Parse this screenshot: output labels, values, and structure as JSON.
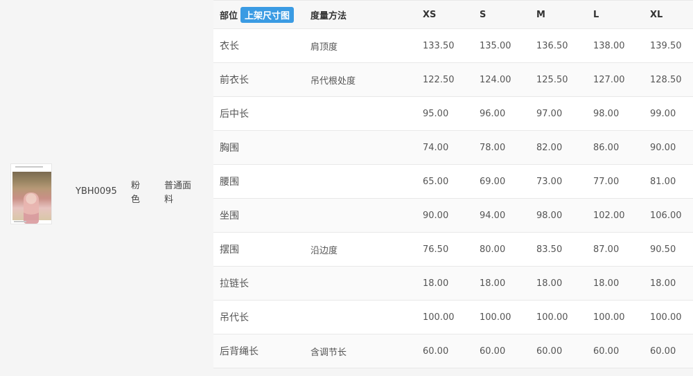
{
  "product": {
    "code": "YBH0095",
    "color": "粉色",
    "fabric": "普通面料"
  },
  "table": {
    "headers": {
      "part": "部位",
      "badge": "上架尺寸图",
      "method": "度量方法",
      "xs": "XS",
      "s": "S",
      "m": "M",
      "l": "L",
      "xl": "XL"
    },
    "rows": [
      {
        "part": "衣长",
        "method": "肩顶度",
        "xs": "133.50",
        "s": "135.00",
        "m": "136.50",
        "l": "138.00",
        "xl": "139.50"
      },
      {
        "part": "前衣长",
        "method": "吊代根处度",
        "xs": "122.50",
        "s": "124.00",
        "m": "125.50",
        "l": "127.00",
        "xl": "128.50"
      },
      {
        "part": "后中长",
        "method": "",
        "xs": "95.00",
        "s": "96.00",
        "m": "97.00",
        "l": "98.00",
        "xl": "99.00"
      },
      {
        "part": "胸围",
        "method": "",
        "xs": "74.00",
        "s": "78.00",
        "m": "82.00",
        "l": "86.00",
        "xl": "90.00"
      },
      {
        "part": "腰围",
        "method": "",
        "xs": "65.00",
        "s": "69.00",
        "m": "73.00",
        "l": "77.00",
        "xl": "81.00"
      },
      {
        "part": "坐围",
        "method": "",
        "xs": "90.00",
        "s": "94.00",
        "m": "98.00",
        "l": "102.00",
        "xl": "106.00"
      },
      {
        "part": "摆围",
        "method": "沿边度",
        "xs": "76.50",
        "s": "80.00",
        "m": "83.50",
        "l": "87.00",
        "xl": "90.50"
      },
      {
        "part": "拉链长",
        "method": "",
        "xs": "18.00",
        "s": "18.00",
        "m": "18.00",
        "l": "18.00",
        "xl": "18.00"
      },
      {
        "part": "吊代长",
        "method": "",
        "xs": "100.00",
        "s": "100.00",
        "m": "100.00",
        "l": "100.00",
        "xl": "100.00"
      },
      {
        "part": "后背绳长",
        "method": "含调节长",
        "xs": "60.00",
        "s": "60.00",
        "m": "60.00",
        "l": "60.00",
        "xl": "60.00"
      }
    ]
  }
}
